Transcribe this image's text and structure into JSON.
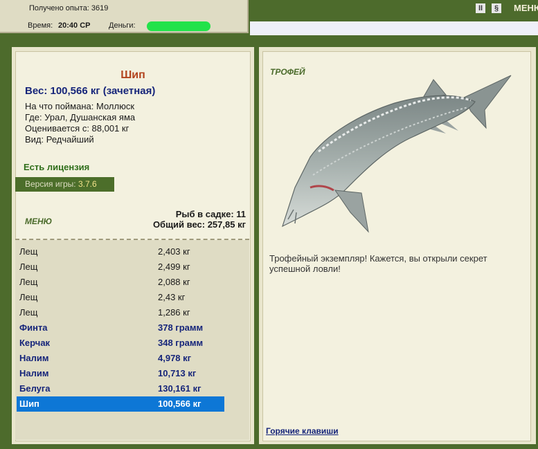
{
  "status": {
    "experience": "Получено опыта: 3619",
    "time_label": "Время:",
    "time_value": "20:40 СР",
    "money_label": "Деньги:",
    "money_hidden_color": "#22e24a"
  },
  "toolbar": {
    "pause_icon": "pause-icon",
    "sound_icon": "sound-icon",
    "menu_label": "МЕНЮ"
  },
  "catch": {
    "name": "Шип",
    "weight_line": "Вес: 100,566 кг (зачетная)",
    "bait": "На что поймана: Моллюск",
    "place": "Где: Урал, Душанская яма",
    "rated_from": "Оценивается с: 88,001 кг",
    "kind": "Вид: Редчайший"
  },
  "license": "Есть лицензия",
  "version": {
    "label": "Версия игры:",
    "value": "3.7.6"
  },
  "menu_label": "МЕНЮ",
  "keepnet": {
    "count_line": "Рыб в садке: 11",
    "total_line": "Общий вес: 257,85 кг"
  },
  "fish_list": [
    {
      "name": "Лещ",
      "weight": "2,403 кг",
      "rare": false,
      "selected": false
    },
    {
      "name": "Лещ",
      "weight": "2,499 кг",
      "rare": false,
      "selected": false
    },
    {
      "name": "Лещ",
      "weight": "2,088 кг",
      "rare": false,
      "selected": false
    },
    {
      "name": "Лещ",
      "weight": "2,43 кг",
      "rare": false,
      "selected": false
    },
    {
      "name": "Лещ",
      "weight": "1,286 кг",
      "rare": false,
      "selected": false
    },
    {
      "name": "Финта",
      "weight": "378 грамм",
      "rare": true,
      "selected": false
    },
    {
      "name": "Керчак",
      "weight": "348 грамм",
      "rare": true,
      "selected": false
    },
    {
      "name": "Налим",
      "weight": "4,978 кг",
      "rare": true,
      "selected": false
    },
    {
      "name": "Налим",
      "weight": "10,713 кг",
      "rare": true,
      "selected": false
    },
    {
      "name": "Белуга",
      "weight": "130,161 кг",
      "rare": true,
      "selected": false
    },
    {
      "name": "Шип",
      "weight": "100,566 кг",
      "rare": true,
      "selected": true
    }
  ],
  "trophy": {
    "title": "ТРОФЕЙ",
    "text": "Трофейный экземпляр! Кажется, вы открыли секрет успешной ловли!",
    "hotkeys": "Горячие клавиши"
  }
}
